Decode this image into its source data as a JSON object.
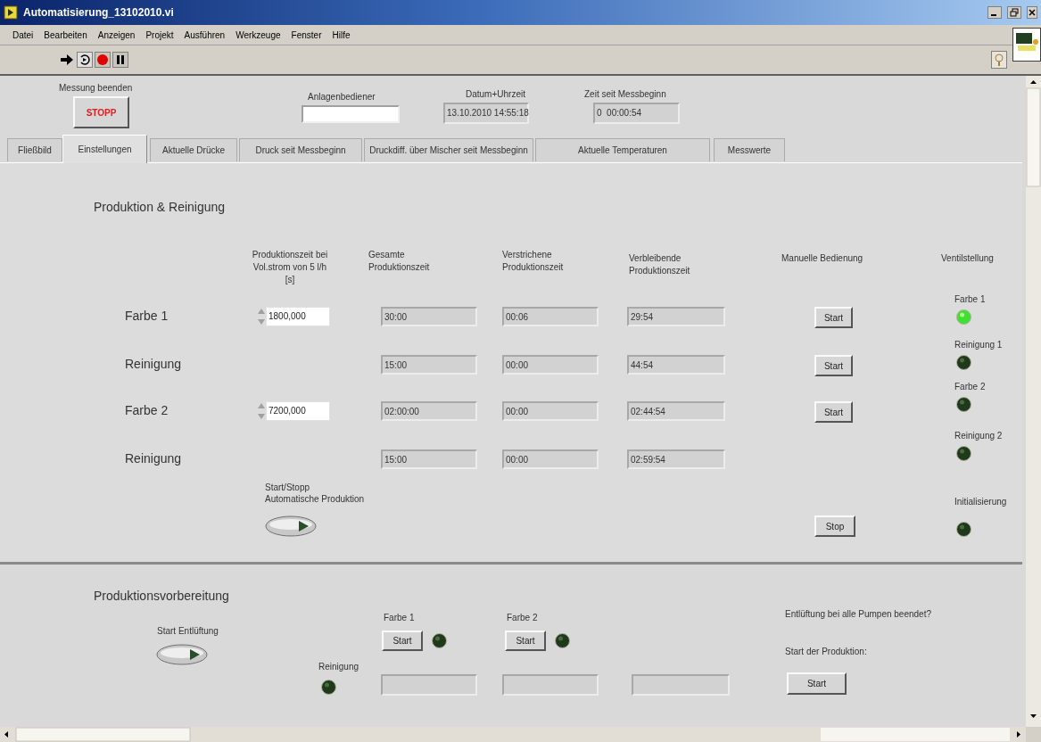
{
  "window": {
    "title": "Automatisierung_13102010.vi"
  },
  "menu": [
    "Datei",
    "Bearbeiten",
    "Anzeigen",
    "Projekt",
    "Ausführen",
    "Werkzeuge",
    "Fenster",
    "Hilfe"
  ],
  "header": {
    "stop_label": "Messung beenden",
    "stop_button": "STOPP",
    "operator_label": "Anlagenbediener",
    "date_label": "Datum+Uhrzeit",
    "date_value": "13.10.2010 14:55:18",
    "elapsed_label": "Zeit seit Messbeginn",
    "elapsed_value": "0  00:00:54"
  },
  "tabs": [
    {
      "label": "Fließbild",
      "selected": false
    },
    {
      "label": "Einstellungen",
      "selected": true
    },
    {
      "label": "Aktuelle Drücke",
      "selected": false
    },
    {
      "label": "Druck seit Messbeginn",
      "selected": false
    },
    {
      "label": "Druckdiff. über Mischer seit Messbeginn",
      "selected": false
    },
    {
      "label": "Aktuelle Temperaturen",
      "selected": false
    },
    {
      "label": "Messwerte",
      "selected": false
    }
  ],
  "production": {
    "title": "Produktion & Reinigung",
    "columns": [
      "Produktionszeit bei\nVol.strom von 5 l/h\n[s]",
      "Gesamte\nProduktionszeit",
      "Verstrichene\nProduktionszeit",
      "Verbleibende\nProduktionszeit",
      "Manuelle Bedienung",
      "Ventilstellung"
    ],
    "rows": [
      {
        "label": "Farbe 1",
        "setpoint": "1800,000",
        "total": "30:00",
        "elapsed": "00:06",
        "remaining": "29:54",
        "button": "Start"
      },
      {
        "label": "Reinigung",
        "total": "15:00",
        "elapsed": "00:00",
        "remaining": "44:54",
        "button": "Start"
      },
      {
        "label": "Farbe 2",
        "setpoint": "7200,000",
        "total": "02:00:00",
        "elapsed": "00:00",
        "remaining": "02:44:54",
        "button": "Start"
      },
      {
        "label": "Reinigung",
        "total": "15:00",
        "elapsed": "00:00",
        "remaining": "02:59:54"
      }
    ],
    "auto_toggle": {
      "label": "Start/Stopp\nAutomatische Produktion",
      "on": false
    },
    "stop_button": "Stop",
    "valves": [
      {
        "label": "Farbe 1",
        "on": true
      },
      {
        "label": "Reinigung 1",
        "on": false
      },
      {
        "label": "Farbe 2",
        "on": false
      },
      {
        "label": "Reinigung 2",
        "on": false
      },
      {
        "label": "Initialisierung",
        "on": false
      }
    ]
  },
  "preparation": {
    "title": "Produktionsvorbereitung",
    "vent_toggle": {
      "label": "Start Entlüftung",
      "on": false
    },
    "units": [
      {
        "label": "Farbe 1",
        "button": "Start",
        "on": false
      },
      {
        "label": "Farbe 2",
        "button": "Start",
        "on": false
      }
    ],
    "cleaning": {
      "label": "Reinigung",
      "on": false
    },
    "question": "Entlüftung bei alle Pumpen beendet?",
    "start_label": "Start der Produktion:",
    "start_button": "Start"
  }
}
